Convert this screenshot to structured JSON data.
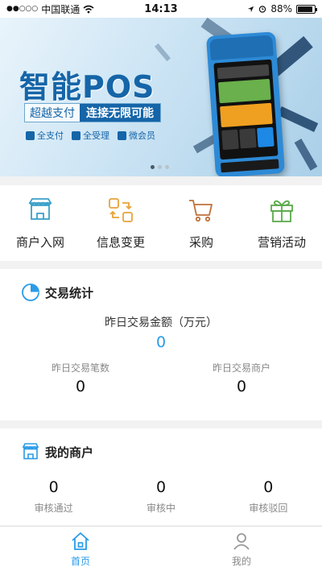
{
  "status_bar": {
    "signal": "●●○○○",
    "carrier": "中国联通",
    "time": "14:13",
    "battery": "88%",
    "battery_level": 0.88
  },
  "banner": {
    "title": "智能POS",
    "tagline_part1": "超越支付",
    "tagline_part2": "连接无限可能",
    "features": [
      "全支付",
      "全受理",
      "微会员"
    ],
    "slide_count": 3,
    "active_slide": 0
  },
  "quick_actions": [
    {
      "label": "商户入网",
      "icon": "store-icon",
      "color": "#3aa0c8"
    },
    {
      "label": "信息变更",
      "icon": "swap-icon",
      "color": "#e8a33a"
    },
    {
      "label": "采购",
      "icon": "cart-icon",
      "color": "#c0703a"
    },
    {
      "label": "营销活动",
      "icon": "gift-icon",
      "color": "#5aaa4a"
    }
  ],
  "stats": {
    "title": "交易统计",
    "main_label": "昨日交易金额（万元）",
    "main_value": "0",
    "count_label": "昨日交易笔数",
    "count_value": "0",
    "merchant_label": "昨日交易商户",
    "merchant_value": "0"
  },
  "merchants": {
    "title": "我的商户",
    "items": [
      {
        "value": "0",
        "label": "审核通过"
      },
      {
        "value": "0",
        "label": "审核中"
      },
      {
        "value": "0",
        "label": "审核驳回"
      }
    ]
  },
  "tabbar": {
    "home_label": "首页",
    "mine_label": "我的"
  },
  "colors": {
    "accent": "#2a9be8",
    "brand": "#1565a8"
  }
}
